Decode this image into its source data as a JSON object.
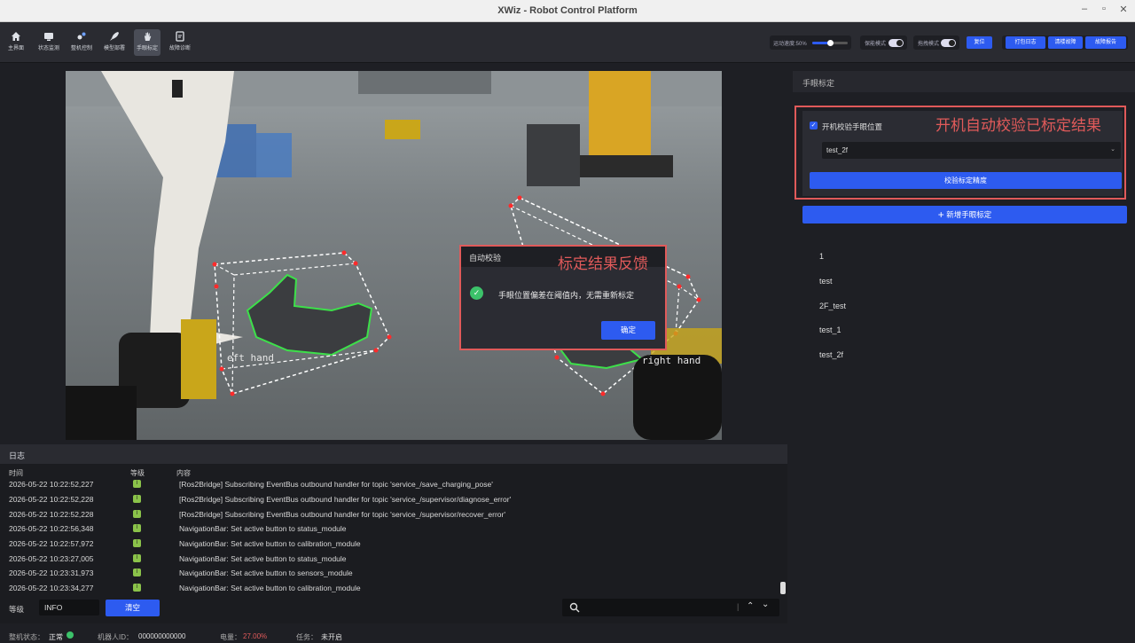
{
  "window": {
    "title": "XWiz - Robot Control Platform",
    "controls": [
      "–",
      "▫",
      "✕"
    ]
  },
  "nav": [
    {
      "label": "主界面",
      "icon": "home-icon"
    },
    {
      "label": "状态监测",
      "icon": "monitor-icon"
    },
    {
      "label": "整机控制",
      "icon": "control-icon"
    },
    {
      "label": "模型部署",
      "icon": "rocket-icon"
    },
    {
      "label": "手眼标定",
      "icon": "hand-icon",
      "active": true
    },
    {
      "label": "故障诊断",
      "icon": "diagnose-icon"
    }
  ],
  "toolbar": {
    "speed_label": "运动速度:50%",
    "speed_level": 0.5,
    "safe_mode_label": "保能模式",
    "drag_mode_label": "拖拽模式",
    "reset_label": "复位",
    "pack_log_label": "打包日志",
    "clear_fault_label": "清楼故障",
    "fault_report_label": "故障报告"
  },
  "video": {
    "left_label": "left hand",
    "right_label": "right hand",
    "left_label_visible": "eft hand"
  },
  "dialog": {
    "title": "自动校验",
    "message": "手眼位置偏差在阈值内，无需重新标定",
    "ok_label": "确定",
    "annotation": "标定结果反馈"
  },
  "right_panel": {
    "title": "手眼标定",
    "auto_check_label": "开机校验手眼位置",
    "auto_check_checked": true,
    "annotation": "开机自动校验已标定结果",
    "selected": "test_2f",
    "verify_label": "校验标定精度",
    "add_label": "新增手眼标定",
    "items": [
      "1",
      "test",
      "2F_test",
      "test_1",
      "test_2f"
    ]
  },
  "log": {
    "title": "日志",
    "columns": {
      "time": "时间",
      "level": "等级",
      "content": "内容"
    },
    "rows": [
      {
        "time": "2026-05-22 10:22:52,227",
        "level": "I",
        "content": "[Ros2Bridge] Subscribing EventBus outbound handler for topic 'service_/save_charging_pose'"
      },
      {
        "time": "2026-05-22 10:22:52,228",
        "level": "I",
        "content": "[Ros2Bridge] Subscribing EventBus outbound handler for topic 'service_/supervisor/diagnose_error'"
      },
      {
        "time": "2026-05-22 10:22:52,228",
        "level": "I",
        "content": "[Ros2Bridge] Subscribing EventBus outbound handler for topic 'service_/supervisor/recover_error'"
      },
      {
        "time": "2026-05-22 10:22:56,348",
        "level": "I",
        "content": "NavigationBar: Set active button to status_module"
      },
      {
        "time": "2026-05-22 10:22:57,972",
        "level": "I",
        "content": "NavigationBar: Set active button to calibration_module"
      },
      {
        "time": "2026-05-22 10:23:27,005",
        "level": "I",
        "content": "NavigationBar: Set active button to status_module"
      },
      {
        "time": "2026-05-22 10:23:31,973",
        "level": "I",
        "content": "NavigationBar: Set active button to sensors_module"
      },
      {
        "time": "2026-05-22 10:23:34,277",
        "level": "I",
        "content": "NavigationBar: Set active button to calibration_module"
      }
    ],
    "level_label": "等级",
    "level_value": "INFO",
    "clear_label": "清空",
    "search_placeholder": ""
  },
  "status": {
    "machine_label": "整机状态：",
    "machine_value": "正常",
    "robot_id_label": "机器人ID：",
    "robot_id_value": "000000000000",
    "battery_label": "电量：",
    "battery_value": "27.00%",
    "task_label": "任务：",
    "task_value": "未开启"
  },
  "colors": {
    "accent": "#2d5bf0",
    "annotation": "#e05a5a",
    "ok": "#3cc26a",
    "battery": "#e05a5a"
  }
}
